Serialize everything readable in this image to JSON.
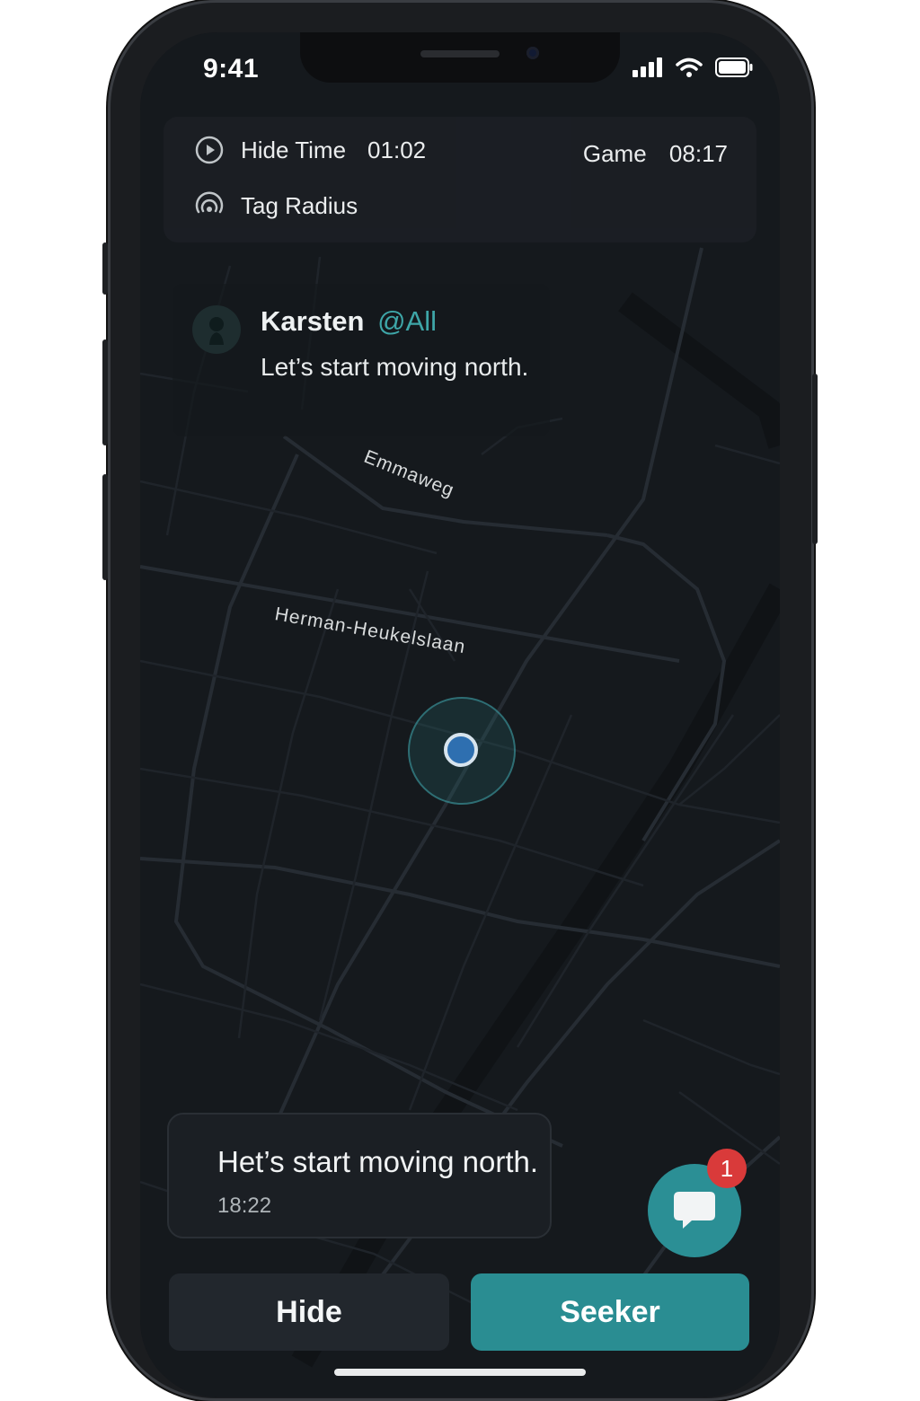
{
  "status_bar": {
    "time": "9:41"
  },
  "hud": {
    "hide_time_label": "Hide Time",
    "hide_time_value": "01:02",
    "game_label": "Game",
    "game_value": "08:17",
    "tag_radius_label": "Tag Radius"
  },
  "chat_message": {
    "sender": "Karsten",
    "mention": "@All",
    "text": "Let’s start moving north."
  },
  "map": {
    "streets": [
      "Emmaweg",
      "Herman-Heukelslaan"
    ]
  },
  "toast": {
    "text": "Het’s start moving north.",
    "time": "18:22"
  },
  "chat_button": {
    "badge_count": "1",
    "icon": "chat-bubble-icon"
  },
  "buttons": {
    "hide_label": "Hide",
    "seeker_label": "Seeker"
  },
  "colors": {
    "accent": "#2a8d92",
    "mention": "#3ea6a8",
    "badge": "#d93a3a",
    "background": "#14181c"
  }
}
